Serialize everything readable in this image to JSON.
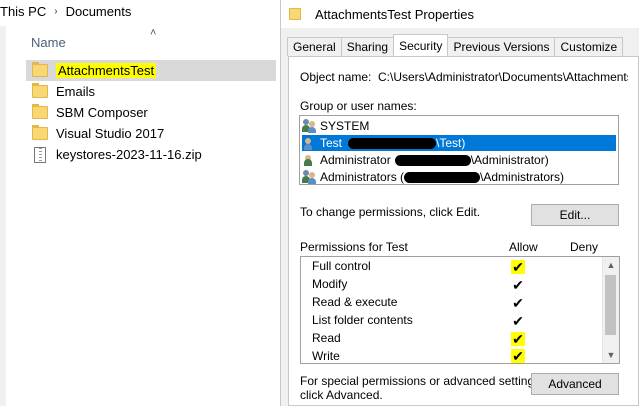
{
  "explorer": {
    "breadcrumb": [
      "This PC",
      "Documents"
    ],
    "column_name": "Name",
    "files": [
      {
        "name": "AttachmentsTest",
        "type": "folder",
        "selected": true
      },
      {
        "name": "Emails",
        "type": "folder"
      },
      {
        "name": "SBM Composer",
        "type": "folder"
      },
      {
        "name": "Visual Studio 2017",
        "type": "folder"
      },
      {
        "name": "keystores-2023-11-16.zip",
        "type": "zip"
      }
    ]
  },
  "dialog": {
    "title": "AttachmentsTest Properties",
    "tabs": [
      "General",
      "Sharing",
      "Security",
      "Previous Versions",
      "Customize"
    ],
    "active_tab": "Security",
    "object_name_label": "Object name:",
    "object_name_value": "C:\\Users\\Administrator\\Documents\\AttachmentsTest",
    "group_label": "Group or user names:",
    "users": [
      {
        "prefix": "SYSTEM",
        "suffix": ""
      },
      {
        "prefix": "Test",
        "suffix": "\\Test)",
        "selected": true
      },
      {
        "prefix": "Administrator",
        "suffix": "\\Administrator)"
      },
      {
        "prefix": "Administrators (",
        "suffix": "\\Administrators)"
      }
    ],
    "change_hint": "To change permissions, click Edit.",
    "edit_button": "Edit...",
    "permissions_label": "Permissions for Test",
    "allow_label": "Allow",
    "deny_label": "Deny",
    "permissions": [
      {
        "name": "Full control",
        "allow": true,
        "highlight": true
      },
      {
        "name": "Modify",
        "allow": true
      },
      {
        "name": "Read & execute",
        "allow": true
      },
      {
        "name": "List folder contents",
        "allow": true
      },
      {
        "name": "Read",
        "allow": true,
        "highlight": true
      },
      {
        "name": "Write",
        "allow": true,
        "highlight": true
      }
    ],
    "special_line1": "For special permissions or advanced settings,",
    "special_line2": "click Advanced.",
    "advanced_button": "Advanced"
  },
  "colors": {
    "selection": "#0078d7",
    "highlight": "#ffff00"
  }
}
